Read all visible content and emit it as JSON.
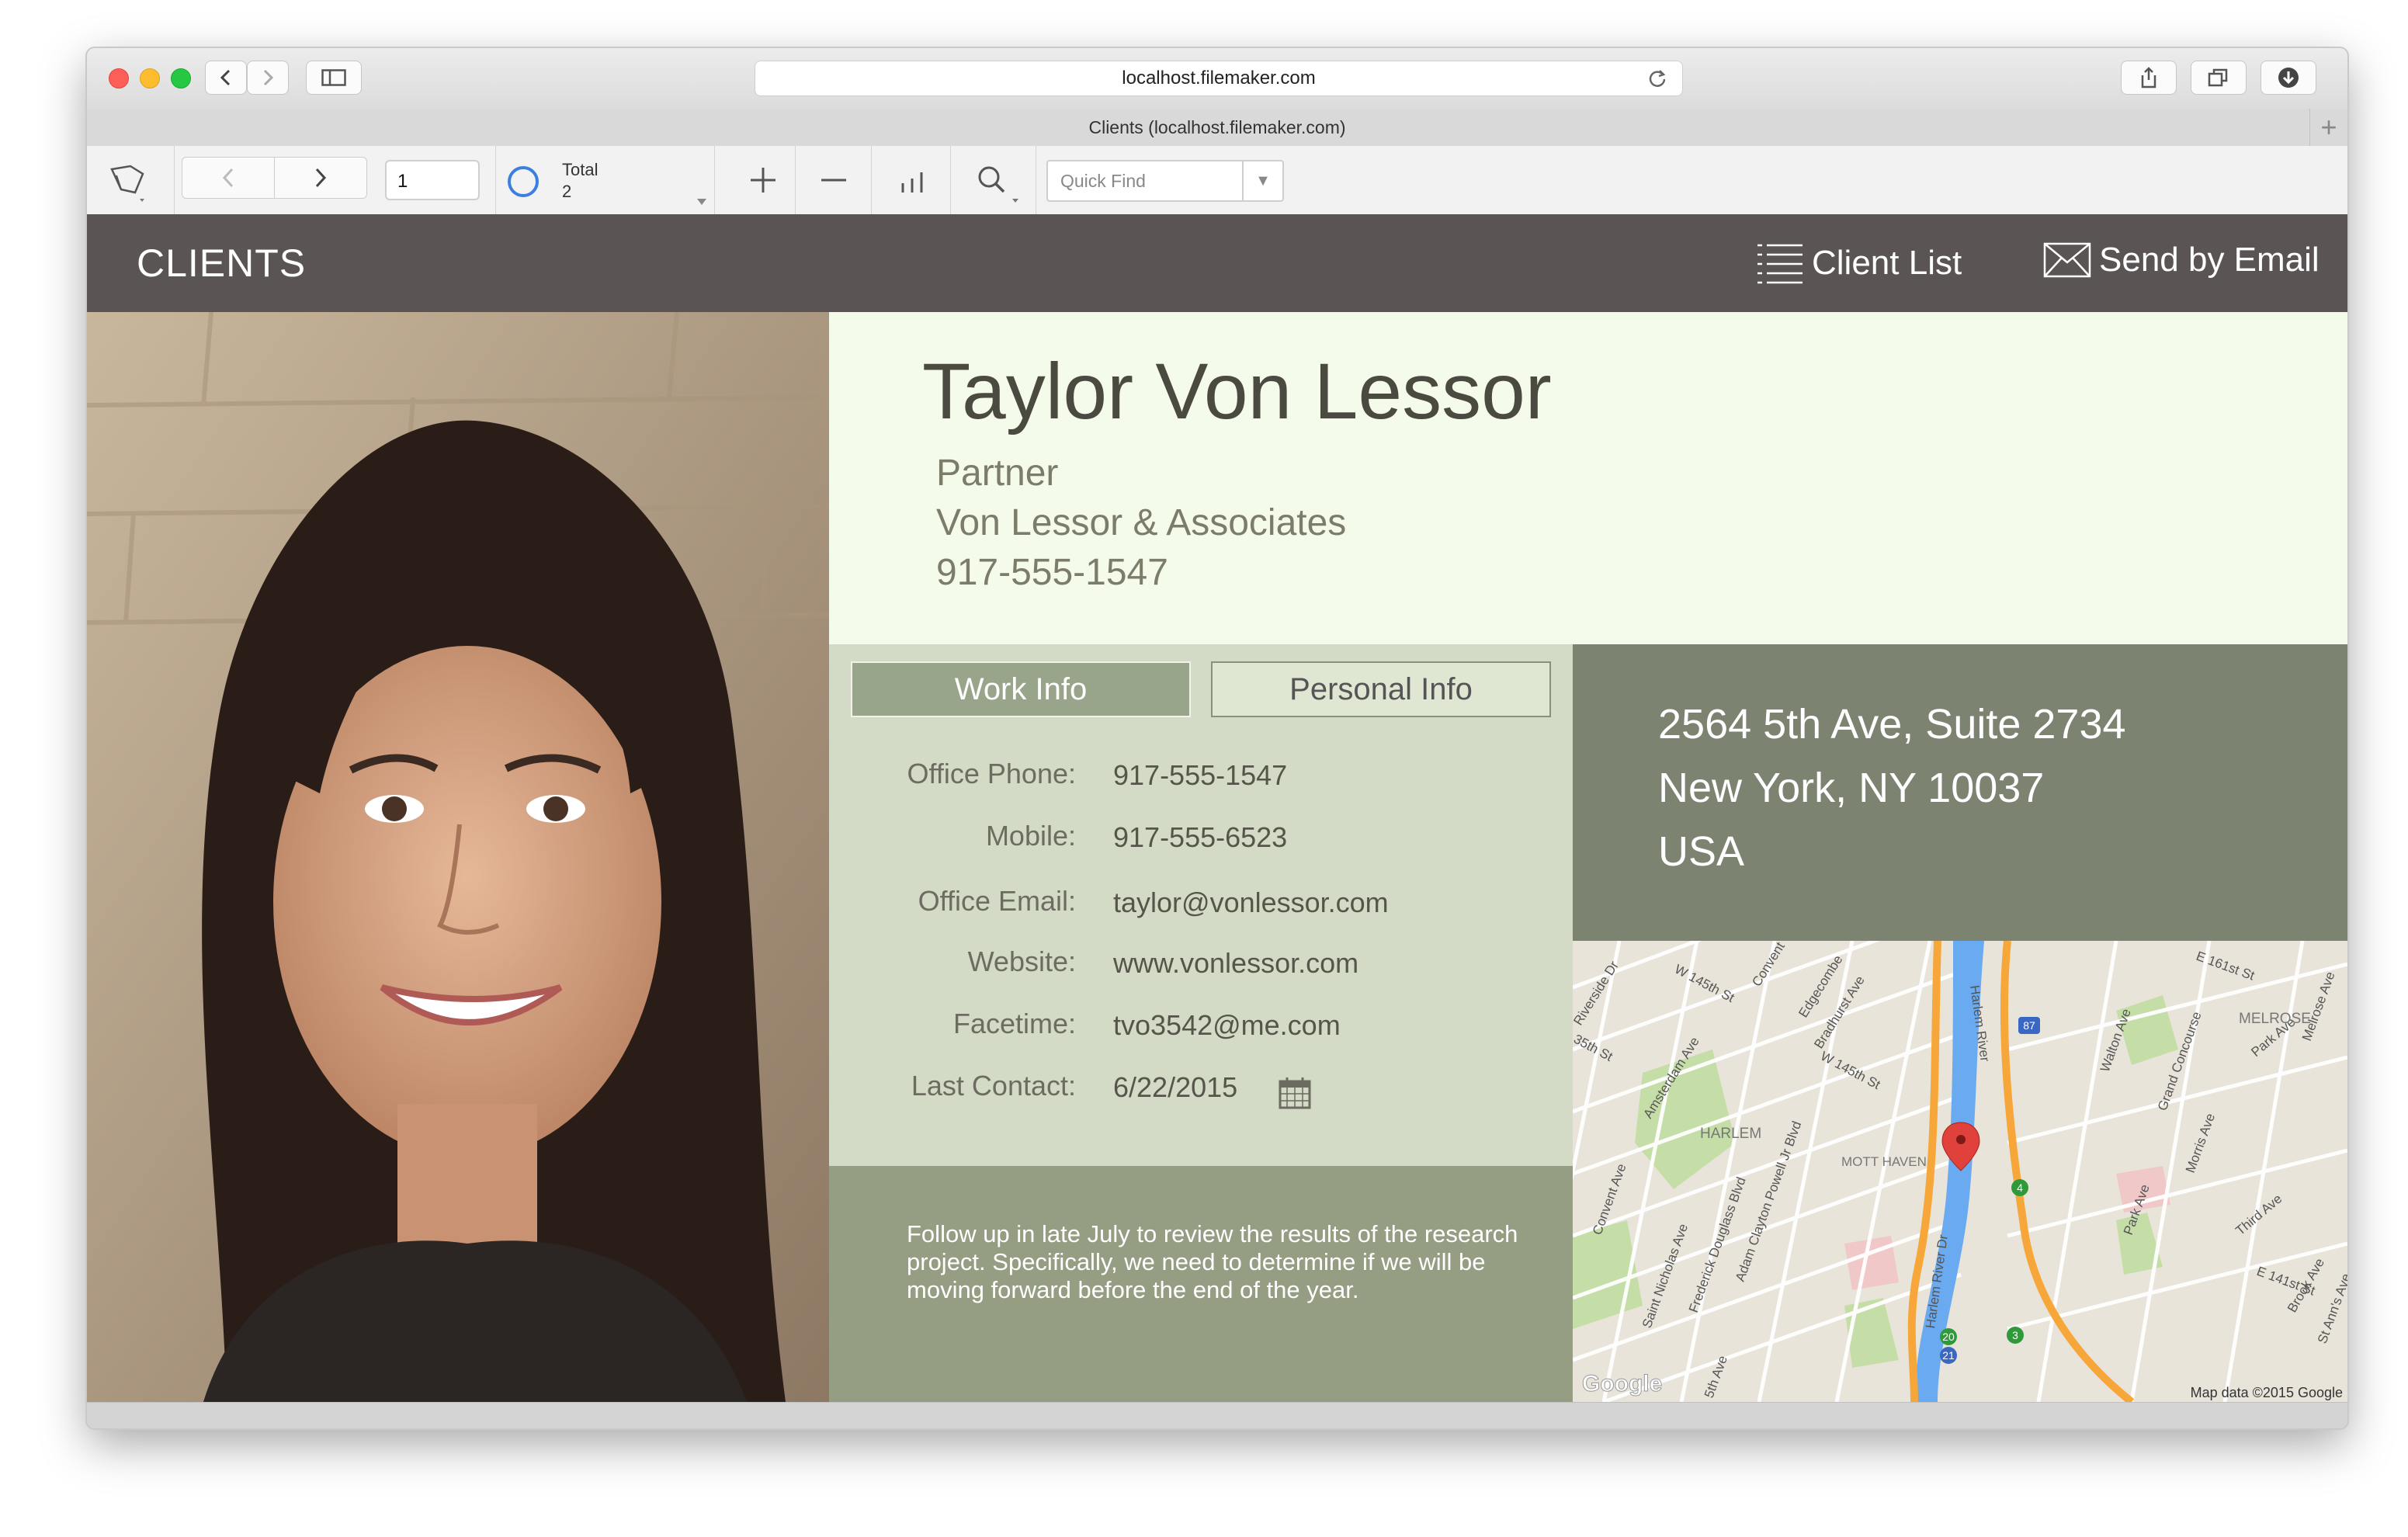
{
  "browser": {
    "url": "localhost.filemaker.com",
    "tab_title": "Clients (localhost.filemaker.com)"
  },
  "toolbar": {
    "record_number": "1",
    "total_label": "Total",
    "total_count": "2",
    "quick_find_placeholder": "Quick Find"
  },
  "header": {
    "title": "CLIENTS",
    "client_list_label": "Client List",
    "send_email_label": "Send by Email"
  },
  "contact": {
    "name": "Taylor Von Lessor",
    "title": "Partner",
    "company": "Von Lessor & Associates",
    "phone": "917-555-1547"
  },
  "tabs": {
    "work": "Work Info",
    "personal": "Personal Info",
    "active": "work"
  },
  "work_info": [
    {
      "label": "Office Phone:",
      "value": "917-555-1547"
    },
    {
      "label": "Mobile:",
      "value": "917-555-6523"
    },
    {
      "label": "Office Email:",
      "value": "taylor@vonlessor.com"
    },
    {
      "label": "Website:",
      "value": "www.vonlessor.com"
    },
    {
      "label": "Facetime:",
      "value": "tvo3542@me.com"
    },
    {
      "label": "Last Contact:",
      "value": "6/22/2015"
    }
  ],
  "notes": "Follow up in late July to review the results of the research project. Specifically, we need to determine if we will be moving forward before the end of the year.",
  "address": {
    "line1": "2564 5th Ave, Suite 2734",
    "line2": "New York, NY  10037",
    "line3": "USA"
  },
  "map": {
    "labels": [
      "Riverside Dr",
      "W 145th St",
      "Convent",
      "Edgecombe",
      "Bradhurst Ave",
      "Amsterdam Ave",
      "W 145th St",
      "Harlem River",
      "E 161st St",
      "Walton Ave",
      "Grand Concourse",
      "Park Ave",
      "Melrose Ave",
      "MELROSE",
      "35th St",
      "Convent Ave",
      "Saint Nicholas Ave",
      "Frederick Douglass Blvd",
      "Adam Clayton Powell Jr Blvd",
      "Harlem River Dr",
      "Morris Ave",
      "Park Ave",
      "Third Ave",
      "E 141st St",
      "Brook Ave",
      "St Ann's Ave",
      "HARLEM",
      "5th Ave",
      "MOTT HAVEN",
      "Google"
    ],
    "shields": [
      "87",
      "4",
      "20",
      "3",
      "21"
    ],
    "attribution": "Map data ©2015 Google",
    "colors": {
      "land": "#e9e4da",
      "water": "#6aaaf0",
      "highway": "#f7a73a",
      "park": "#c5dea8",
      "pin": "#e0413a"
    }
  },
  "colors": {
    "header_bg": "#5a5554",
    "name_panel_bg": "#f5fbea",
    "info_panel_bg": "#d3dbc6",
    "note_panel_bg": "#959e82",
    "address_panel_bg": "#7c8370",
    "active_tab_bg": "#99a58a"
  }
}
